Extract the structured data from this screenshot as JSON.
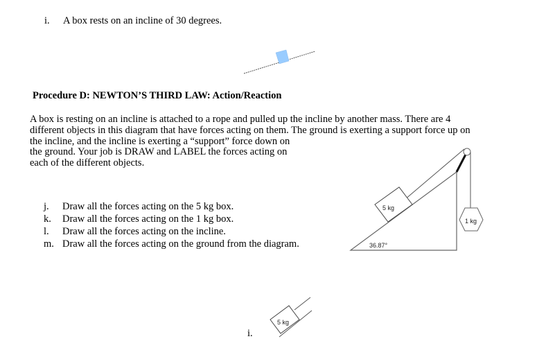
{
  "top_item": {
    "letter": "i.",
    "text": "A box rests on an incline of 30 degrees."
  },
  "heading": "Procedure D: NEWTON’S THIRD LAW: Action/Reaction",
  "paragraph_lines": [
    "A box is resting on an incline is attached to a rope and pulled up the incline by another mass.  There are 4",
    "different objects in this diagram that have forces acting on them.  The ground is exerting a support force up on",
    "the incline, and the incline is exerting a “support” force down on",
    "the ground.  Your job is DRAW and LABEL the forces acting on",
    "each of the different objects."
  ],
  "questions": [
    {
      "letter": "j.",
      "text": "Draw all the forces acting on the 5 kg box."
    },
    {
      "letter": "k.",
      "text": "Draw all the forces acting on the 1 kg box."
    },
    {
      "letter": "l.",
      "text": "Draw all the forces acting on the incline."
    },
    {
      "letter": "m.",
      "text": "Draw all the forces acting on the ground from the diagram."
    }
  ],
  "diagram": {
    "box_label": "5 kg",
    "hanging_mass_label": "1 kg",
    "angle_label": "36.87°"
  },
  "small_diagram": {
    "box_label": "5 kg"
  },
  "bottom_label": "i.",
  "colors": {
    "top_box": "#99ccff",
    "line": "#555555"
  }
}
